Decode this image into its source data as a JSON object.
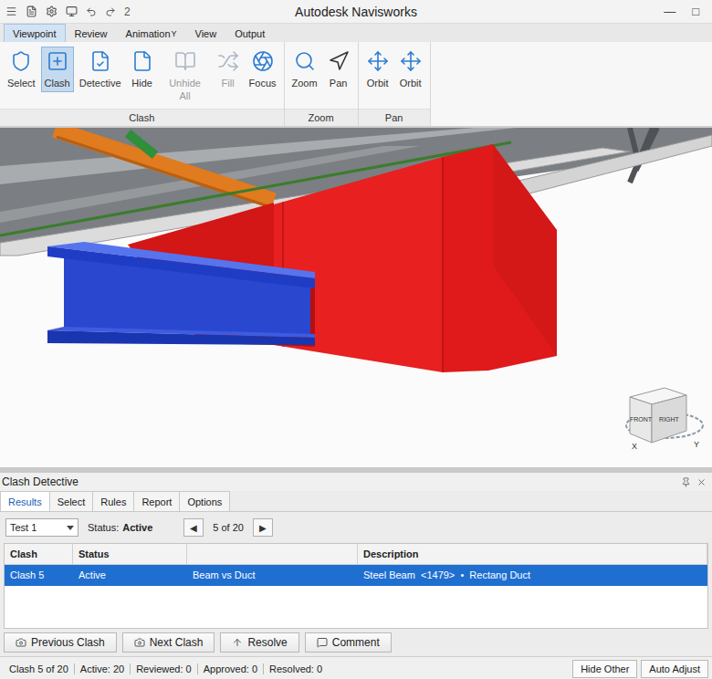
{
  "window": {
    "title": "Autodesk Navisworks",
    "quick_access_label": "2",
    "controls": [
      "—",
      "□"
    ]
  },
  "menu_tabs": [
    {
      "label": "Viewpoint",
      "selected": true
    },
    {
      "label": "Review",
      "selected": false
    },
    {
      "label": "Animation",
      "keytip": "Y",
      "selected": false
    },
    {
      "label": "View",
      "selected": false
    },
    {
      "label": "Output",
      "selected": false
    }
  ],
  "ribbon": {
    "groups": [
      {
        "label": "Clash",
        "buttons": [
          {
            "label": "Select",
            "selected": false,
            "disabled": false
          },
          {
            "label": "Clash",
            "selected": true,
            "disabled": false
          },
          {
            "label": "Detective",
            "selected": false,
            "disabled": false
          },
          {
            "label": "Hide",
            "selected": false,
            "disabled": false
          },
          {
            "label": "Unhide All",
            "selected": false,
            "disabled": true
          },
          {
            "label": "Fill",
            "selected": false,
            "disabled": true
          },
          {
            "label": "Focus",
            "selected": false,
            "disabled": false
          }
        ]
      },
      {
        "label": "Zoom",
        "buttons": [
          {
            "label": "Zoom",
            "selected": false,
            "disabled": false
          },
          {
            "label": "Pan",
            "selected": false,
            "disabled": false
          }
        ]
      },
      {
        "label": "Pan",
        "buttons": [
          {
            "label": "Orbit",
            "selected": false,
            "disabled": false
          },
          {
            "label": "Orbit",
            "selected": false,
            "disabled": false
          }
        ]
      }
    ]
  },
  "viewport": {
    "viewcube": {
      "faces": [
        "FRONT",
        "RIGHT"
      ],
      "axes": [
        "X",
        "Y"
      ]
    }
  },
  "clash_detective": {
    "title": "Clash Detective",
    "tabs": [
      {
        "label": "Results",
        "selected": true
      },
      {
        "label": "Select",
        "selected": false
      },
      {
        "label": "Rules",
        "selected": false
      },
      {
        "label": "Report",
        "selected": false
      },
      {
        "label": "Options",
        "selected": false
      }
    ],
    "test": {
      "value": "Test 1"
    },
    "status_label": "Status:",
    "status": "Active",
    "nav": {
      "prev": "◀",
      "position": "5 of 20",
      "next": "▶"
    },
    "table": {
      "columns": [
        "Clash",
        "Status",
        "",
        "Description"
      ],
      "rows": [
        {
          "cells": [
            "Clash 5",
            "Active",
            "Beam vs Duct",
            "Steel Beam  <1479>  •  Rectang Duct"
          ],
          "selected": true
        }
      ]
    },
    "buttons": [
      "Previous Clash",
      "Next Clash",
      "Resolve",
      "Comment"
    ],
    "status_bar": {
      "items": [
        "Clash 5 of 20",
        "Active: 20",
        "Reviewed: 0",
        "Approved: 0",
        "Resolved: 0"
      ],
      "buttons": [
        "Hide Other",
        "Auto Adjust"
      ]
    }
  }
}
